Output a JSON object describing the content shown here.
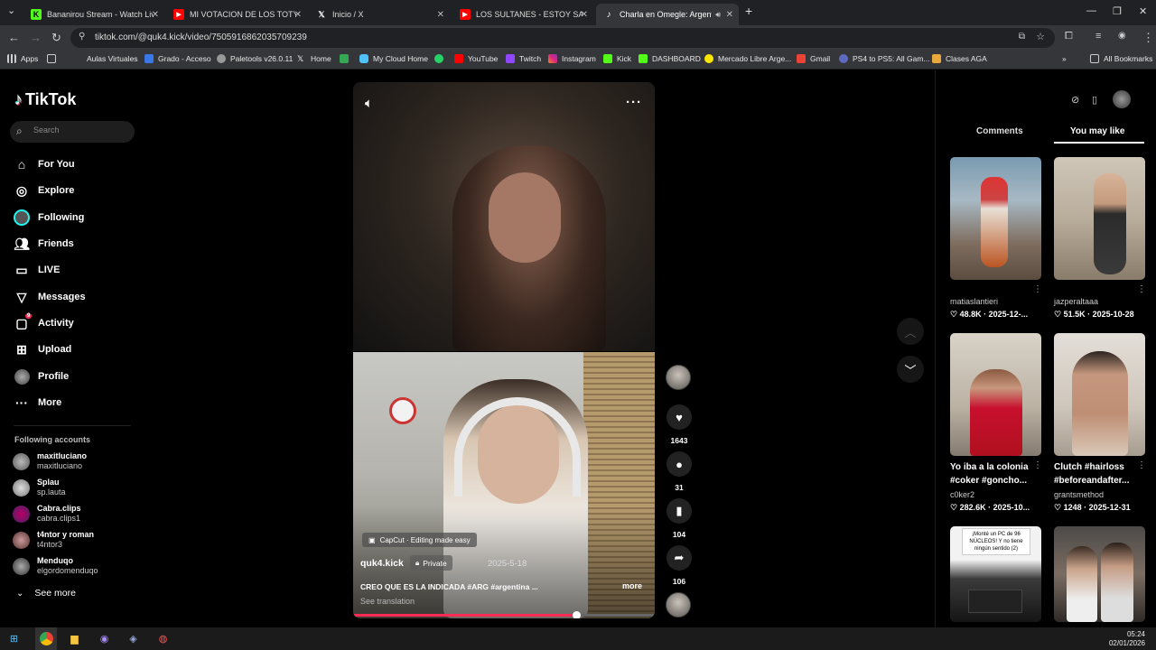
{
  "browser": {
    "tabs": [
      {
        "title": "Bananirou Stream - Watch Live",
        "icon": "kick-icon",
        "color": "#53fc18"
      },
      {
        "title": "MI VOTACION DE LOS TOTY (1/",
        "icon": "youtube-icon",
        "color": "#ff0000"
      },
      {
        "title": "Inicio / X",
        "icon": "x-icon",
        "color": "#ffffff"
      },
      {
        "title": "LOS SULTANES - ESTOY SALIEN",
        "icon": "youtube-icon",
        "color": "#ff0000"
      },
      {
        "title": "Charla en Omegle: Argentin",
        "icon": "tiktok-icon",
        "color": "#ffffff",
        "active": true
      }
    ],
    "url": "tiktok.com/@quk4.kick/video/7505916862035709239",
    "bookmarks": [
      "Apps",
      "Aulas Virtuales",
      "Grado - Acceso",
      "Paletools v26.0.11",
      "Home",
      "My Cloud Home",
      "YouTube",
      "Twitch",
      "Instagram",
      "Kick",
      "DASHBOARD",
      "Mercado Libre Arge...",
      "Gmail",
      "PS4 to PS5: All Gam...",
      "Clases AGA"
    ],
    "all_bookmarks": "All Bookmarks"
  },
  "sidebar": {
    "brand": "TikTok",
    "search_placeholder": "Search",
    "nav": [
      {
        "label": "For You",
        "icon": "home-icon"
      },
      {
        "label": "Explore",
        "icon": "compass-icon"
      },
      {
        "label": "Following",
        "icon": "following-avatar-icon"
      },
      {
        "label": "Friends",
        "icon": "friends-icon"
      },
      {
        "label": "LIVE",
        "icon": "live-icon"
      },
      {
        "label": "Messages",
        "icon": "messages-icon"
      },
      {
        "label": "Activity",
        "icon": "activity-icon",
        "badge": "9"
      },
      {
        "label": "Upload",
        "icon": "upload-icon"
      },
      {
        "label": "Profile",
        "icon": "profile-avatar-icon"
      },
      {
        "label": "More",
        "icon": "more-icon"
      }
    ],
    "following_title": "Following accounts",
    "accounts": [
      {
        "name": "maxitluciano",
        "handle": "maxitluciano"
      },
      {
        "name": "Splau",
        "handle": "sp.lauta"
      },
      {
        "name": "Cabra.clips",
        "handle": "cabra.clips1"
      },
      {
        "name": "t4ntor y roman",
        "handle": "t4ntor3"
      },
      {
        "name": "Menduqo",
        "handle": "elgordomenduqo"
      }
    ],
    "see_more": "See more"
  },
  "video": {
    "capcut": "CapCut · Editing made easy",
    "author": "quk4.kick",
    "private": "Private",
    "date": "2025-5-18",
    "caption": "CREO QUE ES LA INDICADA #ARG #argentina ...",
    "more": "more",
    "see_translation": "See translation",
    "progress": 0.74,
    "likes": "1643",
    "comments": "31",
    "saves": "104",
    "shares": "106"
  },
  "right_panel": {
    "tab_comments": "Comments",
    "tab_you_may_like": "You may like",
    "cards": [
      {
        "author": "matiaslantieri",
        "likes": "48.8K",
        "date": "2025-12-..."
      },
      {
        "author": "jazperaltaaa",
        "likes": "51.5K",
        "date": "2025-10-28"
      },
      {
        "title": "Yo iba a la colonia #coker #goncho...",
        "author": "c0ker2",
        "likes": "282.6K",
        "date": "2025-10..."
      },
      {
        "title": "Clutch #hairloss #beforeandafter...",
        "author": "grantsmethod",
        "likes": "1248",
        "date": "2025-12-31"
      },
      {
        "overlay": "¡Monté un PC de 96 NÚCLEOS! Y no tiene ningún sentido (2)"
      },
      {}
    ]
  },
  "taskbar": {
    "time": "05:24",
    "date": "02/01/2026"
  }
}
